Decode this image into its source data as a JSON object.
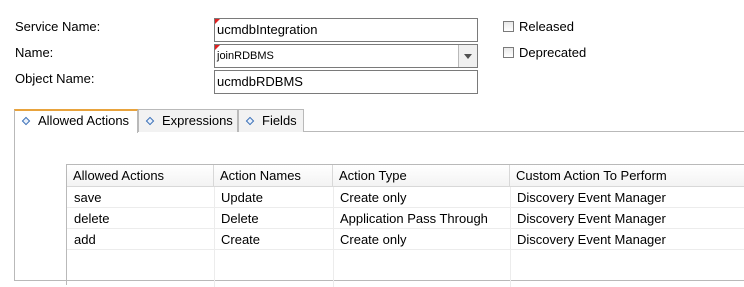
{
  "form": {
    "service_name_label": "Service Name:",
    "service_name_value": "ucmdbIntegration",
    "name_label": "Name:",
    "name_value": "joinRDBMS",
    "object_name_label": "Object Name:",
    "object_name_value": "ucmdbRDBMS",
    "released_label": "Released",
    "deprecated_label": "Deprecated"
  },
  "tabs": [
    {
      "label": "Allowed Actions",
      "icon": "diamond-icon",
      "active": true
    },
    {
      "label": "Expressions",
      "icon": "diamond-icon",
      "active": false
    },
    {
      "label": "Fields",
      "icon": "diamond-icon",
      "active": false
    }
  ],
  "table": {
    "columns": [
      "Allowed Actions",
      "Action Names",
      "Action Type",
      "Custom Action To Perform"
    ],
    "rows": [
      [
        "save",
        "Update",
        "Create only",
        "Discovery Event Manager"
      ],
      [
        "delete",
        "Delete",
        "Application Pass Through",
        "Discovery Event Manager"
      ],
      [
        "add",
        "Create",
        "Create only",
        "Discovery Event Manager"
      ]
    ]
  },
  "colors": {
    "required_marker": "#e02020",
    "active_tab_accent": "#e8a33d",
    "tab_icon": "#3a6fb6"
  }
}
